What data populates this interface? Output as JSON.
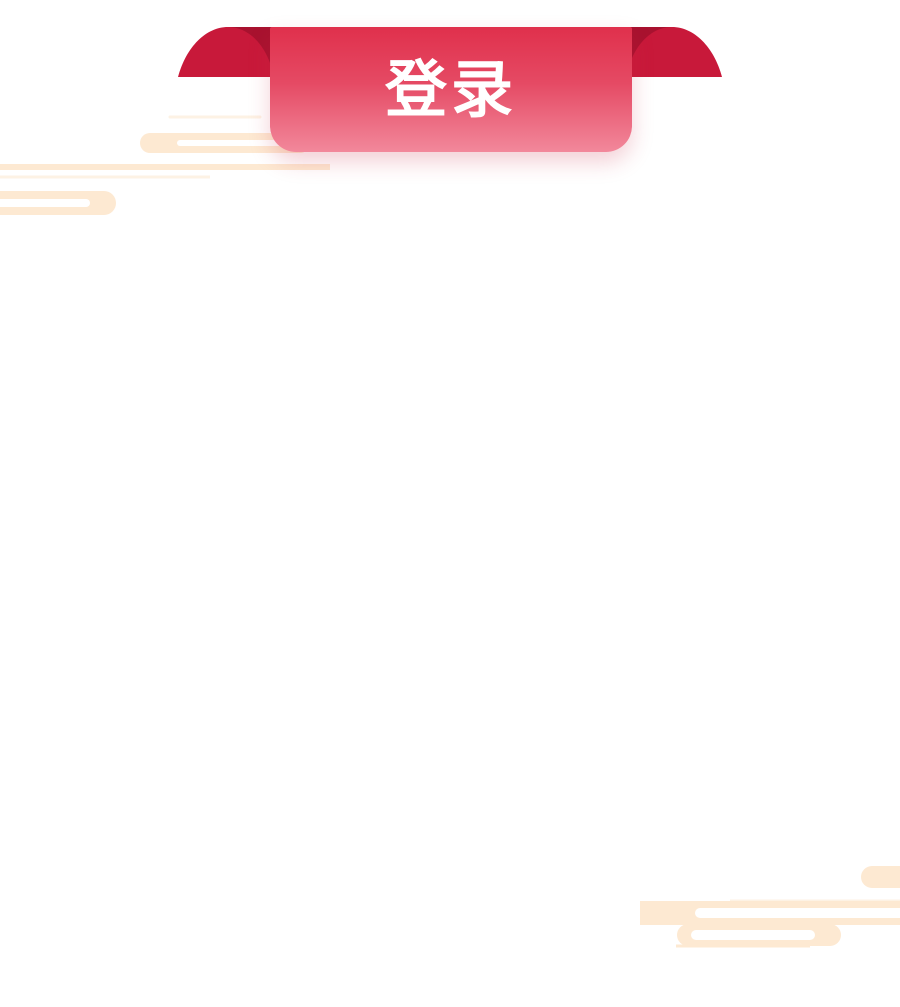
{
  "header": {
    "title": "登录"
  },
  "colors": {
    "ribbon_dark": "#c8193a",
    "ribbon_top": "#e0304c",
    "ribbon_bottom": "#f2889b",
    "cloud": "#fde9d2",
    "background": "#ffffff"
  },
  "decorations": {
    "top_left": "cloud-streak-decoration",
    "bottom_right": "cloud-streak-decoration"
  }
}
